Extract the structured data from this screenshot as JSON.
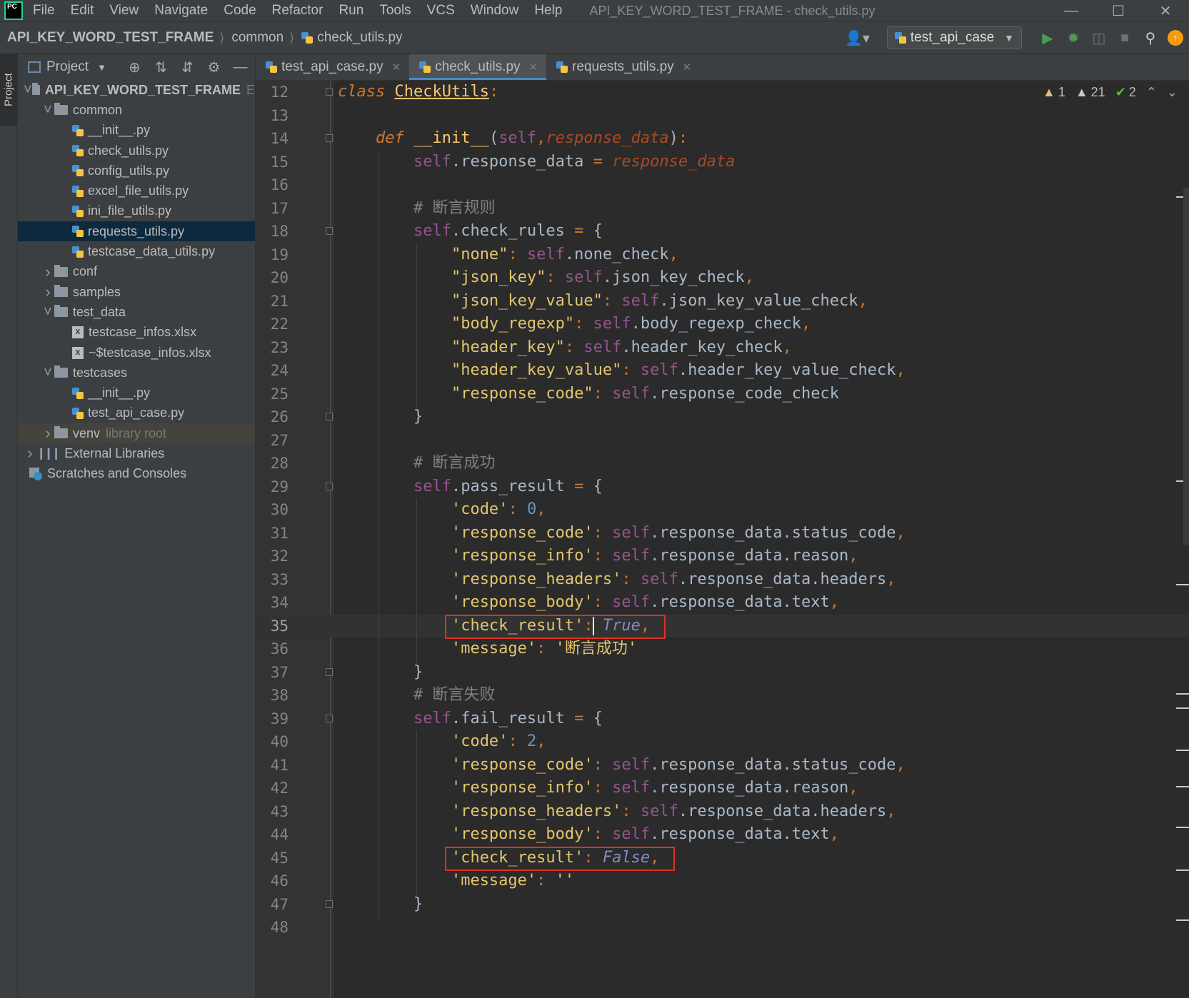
{
  "menu": {
    "logo": "PC",
    "items": [
      "File",
      "Edit",
      "View",
      "Navigate",
      "Code",
      "Refactor",
      "Run",
      "Tools",
      "VCS",
      "Window",
      "Help"
    ],
    "window_title": "API_KEY_WORD_TEST_FRAME - check_utils.py"
  },
  "breadcrumb": {
    "project": "API_KEY_WORD_TEST_FRAME",
    "folder": "common",
    "file": "check_utils.py"
  },
  "toolbar": {
    "run_config": "test_api_case"
  },
  "left_stripe": {
    "tab": "Project"
  },
  "project_panel": {
    "title": "Project",
    "tree": [
      {
        "label": "API_KEY_WORD_TEST_FRAME",
        "hint": "E",
        "type": "folder",
        "depth": 0,
        "expanded": true,
        "bold": true
      },
      {
        "label": "common",
        "type": "folder",
        "depth": 1,
        "expanded": true
      },
      {
        "label": "__init__.py",
        "type": "py",
        "depth": 2
      },
      {
        "label": "check_utils.py",
        "type": "py",
        "depth": 2
      },
      {
        "label": "config_utils.py",
        "type": "py",
        "depth": 2
      },
      {
        "label": "excel_file_utils.py",
        "type": "py",
        "depth": 2
      },
      {
        "label": "ini_file_utils.py",
        "type": "py",
        "depth": 2
      },
      {
        "label": "requests_utils.py",
        "type": "py",
        "depth": 2,
        "selected": true
      },
      {
        "label": "testcase_data_utils.py",
        "type": "py",
        "depth": 2
      },
      {
        "label": "conf",
        "type": "folder",
        "depth": 1,
        "expanded": false
      },
      {
        "label": "samples",
        "type": "folder",
        "depth": 1,
        "expanded": false
      },
      {
        "label": "test_data",
        "type": "folder",
        "depth": 1,
        "expanded": true
      },
      {
        "label": "testcase_infos.xlsx",
        "type": "xls",
        "depth": 2
      },
      {
        "label": "~$testcase_infos.xlsx",
        "type": "xls",
        "depth": 2
      },
      {
        "label": "testcases",
        "type": "folder",
        "depth": 1,
        "expanded": true
      },
      {
        "label": "__init__.py",
        "type": "py",
        "depth": 2
      },
      {
        "label": "test_api_case.py",
        "type": "py",
        "depth": 2
      },
      {
        "label": "venv",
        "hint": "library root",
        "type": "folder",
        "depth": 1,
        "expanded": false,
        "venv": true
      },
      {
        "label": "External Libraries",
        "type": "lib",
        "depth": 0,
        "expanded": false
      },
      {
        "label": "Scratches and Consoles",
        "type": "scratch",
        "depth": 0
      }
    ]
  },
  "tabs": [
    {
      "label": "test_api_case.py",
      "active": false
    },
    {
      "label": "check_utils.py",
      "active": true
    },
    {
      "label": "requests_utils.py",
      "active": false
    }
  ],
  "inspections": {
    "warnings_yellow": "1",
    "warnings": "21",
    "ok": "2"
  },
  "editor": {
    "current_line": 35,
    "lines": [
      {
        "n": "12",
        "fold": true,
        "tokens": [
          [
            "kwi",
            "class "
          ],
          [
            "cls",
            "CheckUtils"
          ],
          [
            "punc",
            ":"
          ]
        ]
      },
      {
        "n": "13",
        "tokens": []
      },
      {
        "n": "14",
        "fold": true,
        "tokens": [
          [
            "",
            "    "
          ],
          [
            "kwi",
            "def "
          ],
          [
            "fn",
            "__init__"
          ],
          [
            "",
            "("
          ],
          [
            "slf",
            "self"
          ],
          [
            "punc",
            ","
          ],
          [
            "param",
            "response_data"
          ],
          [
            "",
            ")"
          ],
          [
            "punc",
            ":"
          ]
        ]
      },
      {
        "n": "15",
        "tokens": [
          [
            "",
            "        "
          ],
          [
            "slf",
            "self"
          ],
          [
            "",
            ".response_data "
          ],
          [
            "punc",
            "="
          ],
          [
            "",
            " "
          ],
          [
            "param",
            "response_data"
          ]
        ]
      },
      {
        "n": "16",
        "tokens": []
      },
      {
        "n": "17",
        "tokens": [
          [
            "",
            "        "
          ],
          [
            "cmt",
            "# 断言规则"
          ]
        ]
      },
      {
        "n": "18",
        "fold": true,
        "tokens": [
          [
            "",
            "        "
          ],
          [
            "slf",
            "self"
          ],
          [
            "",
            ".check_rules "
          ],
          [
            "punc",
            "="
          ],
          [
            "",
            " {"
          ]
        ]
      },
      {
        "n": "19",
        "tokens": [
          [
            "",
            "            "
          ],
          [
            "str2",
            "\"none\""
          ],
          [
            "punc",
            ":"
          ],
          [
            "",
            " "
          ],
          [
            "slf",
            "self"
          ],
          [
            "",
            ".none_check"
          ],
          [
            "punc",
            ","
          ]
        ]
      },
      {
        "n": "20",
        "tokens": [
          [
            "",
            "            "
          ],
          [
            "str2",
            "\"json_key\""
          ],
          [
            "punc",
            ":"
          ],
          [
            "",
            " "
          ],
          [
            "slf",
            "self"
          ],
          [
            "",
            ".json_key_check"
          ],
          [
            "punc",
            ","
          ]
        ]
      },
      {
        "n": "21",
        "tokens": [
          [
            "",
            "            "
          ],
          [
            "str2",
            "\"json_key_value\""
          ],
          [
            "punc",
            ":"
          ],
          [
            "",
            " "
          ],
          [
            "slf",
            "self"
          ],
          [
            "",
            ".json_key_value_check"
          ],
          [
            "punc",
            ","
          ]
        ]
      },
      {
        "n": "22",
        "tokens": [
          [
            "",
            "            "
          ],
          [
            "str2",
            "\"body_regexp\""
          ],
          [
            "punc",
            ":"
          ],
          [
            "",
            " "
          ],
          [
            "slf",
            "self"
          ],
          [
            "",
            ".body_regexp_check"
          ],
          [
            "punc",
            ","
          ]
        ]
      },
      {
        "n": "23",
        "tokens": [
          [
            "",
            "            "
          ],
          [
            "str2",
            "\"header_key\""
          ],
          [
            "punc",
            ":"
          ],
          [
            "",
            " "
          ],
          [
            "slf",
            "self"
          ],
          [
            "",
            ".header_key_check"
          ],
          [
            "punc",
            ","
          ]
        ]
      },
      {
        "n": "24",
        "tokens": [
          [
            "",
            "            "
          ],
          [
            "str2",
            "\"header_key_value\""
          ],
          [
            "punc",
            ":"
          ],
          [
            "",
            " "
          ],
          [
            "slf",
            "self"
          ],
          [
            "",
            ".header_key_value_check"
          ],
          [
            "punc",
            ","
          ]
        ]
      },
      {
        "n": "25",
        "tokens": [
          [
            "",
            "            "
          ],
          [
            "str2",
            "\"response_code\""
          ],
          [
            "punc",
            ":"
          ],
          [
            "",
            " "
          ],
          [
            "slf",
            "self"
          ],
          [
            "",
            ".response_code_check"
          ]
        ]
      },
      {
        "n": "26",
        "fold": true,
        "tokens": [
          [
            "",
            "        }"
          ]
        ]
      },
      {
        "n": "27",
        "tokens": []
      },
      {
        "n": "28",
        "tokens": [
          [
            "",
            "        "
          ],
          [
            "cmt",
            "# 断言成功"
          ]
        ]
      },
      {
        "n": "29",
        "fold": true,
        "tokens": [
          [
            "",
            "        "
          ],
          [
            "slf",
            "self"
          ],
          [
            "",
            ".pass_result "
          ],
          [
            "punc",
            "="
          ],
          [
            "",
            " {"
          ]
        ]
      },
      {
        "n": "30",
        "tokens": [
          [
            "",
            "            "
          ],
          [
            "str2",
            "'code'"
          ],
          [
            "punc",
            ":"
          ],
          [
            "",
            " "
          ],
          [
            "num",
            "0"
          ],
          [
            "punc",
            ","
          ]
        ]
      },
      {
        "n": "31",
        "tokens": [
          [
            "",
            "            "
          ],
          [
            "str2",
            "'response_code'"
          ],
          [
            "punc",
            ":"
          ],
          [
            "",
            " "
          ],
          [
            "slf",
            "self"
          ],
          [
            "",
            ".response_data.status_code"
          ],
          [
            "punc",
            ","
          ]
        ]
      },
      {
        "n": "32",
        "tokens": [
          [
            "",
            "            "
          ],
          [
            "str2",
            "'response_info'"
          ],
          [
            "punc",
            ":"
          ],
          [
            "",
            " "
          ],
          [
            "slf",
            "self"
          ],
          [
            "",
            ".response_data.reason"
          ],
          [
            "punc",
            ","
          ]
        ]
      },
      {
        "n": "33",
        "tokens": [
          [
            "",
            "            "
          ],
          [
            "str2",
            "'response_headers'"
          ],
          [
            "punc",
            ":"
          ],
          [
            "",
            " "
          ],
          [
            "slf",
            "self"
          ],
          [
            "",
            ".response_data.headers"
          ],
          [
            "punc",
            ","
          ]
        ]
      },
      {
        "n": "34",
        "tokens": [
          [
            "",
            "            "
          ],
          [
            "str2",
            "'response_body'"
          ],
          [
            "punc",
            ":"
          ],
          [
            "",
            " "
          ],
          [
            "slf",
            "self"
          ],
          [
            "",
            ".response_data.text"
          ],
          [
            "punc",
            ","
          ]
        ]
      },
      {
        "n": "35",
        "tokens": [
          [
            "",
            "            "
          ],
          [
            "str2",
            "'check_result'"
          ],
          [
            "punc",
            ":"
          ],
          [
            "",
            " "
          ],
          [
            "bool",
            "True"
          ],
          [
            "punc",
            ","
          ]
        ]
      },
      {
        "n": "36",
        "tokens": [
          [
            "",
            "            "
          ],
          [
            "str2",
            "'message'"
          ],
          [
            "punc",
            ":"
          ],
          [
            "",
            " "
          ],
          [
            "str2",
            "'断言成功'"
          ]
        ]
      },
      {
        "n": "37",
        "fold": true,
        "tokens": [
          [
            "",
            "        }"
          ]
        ]
      },
      {
        "n": "38",
        "tokens": [
          [
            "",
            "        "
          ],
          [
            "cmt",
            "# 断言失败"
          ]
        ]
      },
      {
        "n": "39",
        "fold": true,
        "tokens": [
          [
            "",
            "        "
          ],
          [
            "slf",
            "self"
          ],
          [
            "",
            ".fail_result "
          ],
          [
            "punc",
            "="
          ],
          [
            "",
            " {"
          ]
        ]
      },
      {
        "n": "40",
        "tokens": [
          [
            "",
            "            "
          ],
          [
            "str2",
            "'code'"
          ],
          [
            "punc",
            ":"
          ],
          [
            "",
            " "
          ],
          [
            "num",
            "2"
          ],
          [
            "punc",
            ","
          ]
        ]
      },
      {
        "n": "41",
        "tokens": [
          [
            "",
            "            "
          ],
          [
            "str2",
            "'response_code'"
          ],
          [
            "punc",
            ":"
          ],
          [
            "",
            " "
          ],
          [
            "slf",
            "self"
          ],
          [
            "",
            ".response_data.status_code"
          ],
          [
            "punc",
            ","
          ]
        ]
      },
      {
        "n": "42",
        "tokens": [
          [
            "",
            "            "
          ],
          [
            "str2",
            "'response_info'"
          ],
          [
            "punc",
            ":"
          ],
          [
            "",
            " "
          ],
          [
            "slf",
            "self"
          ],
          [
            "",
            ".response_data.reason"
          ],
          [
            "punc",
            ","
          ]
        ]
      },
      {
        "n": "43",
        "tokens": [
          [
            "",
            "            "
          ],
          [
            "str2",
            "'response_headers'"
          ],
          [
            "punc",
            ":"
          ],
          [
            "",
            " "
          ],
          [
            "slf",
            "self"
          ],
          [
            "",
            ".response_data.headers"
          ],
          [
            "punc",
            ","
          ]
        ]
      },
      {
        "n": "44",
        "tokens": [
          [
            "",
            "            "
          ],
          [
            "str2",
            "'response_body'"
          ],
          [
            "punc",
            ":"
          ],
          [
            "",
            " "
          ],
          [
            "slf",
            "self"
          ],
          [
            "",
            ".response_data.text"
          ],
          [
            "punc",
            ","
          ]
        ]
      },
      {
        "n": "45",
        "tokens": [
          [
            "",
            "            "
          ],
          [
            "str2",
            "'check_result'"
          ],
          [
            "punc",
            ":"
          ],
          [
            "",
            " "
          ],
          [
            "bool",
            "False"
          ],
          [
            "punc",
            ","
          ]
        ]
      },
      {
        "n": "46",
        "tokens": [
          [
            "",
            "            "
          ],
          [
            "str2",
            "'message'"
          ],
          [
            "punc",
            ":"
          ],
          [
            "",
            " "
          ],
          [
            "str2",
            "''"
          ]
        ]
      },
      {
        "n": "47",
        "fold": true,
        "tokens": [
          [
            "",
            "        }"
          ]
        ]
      },
      {
        "n": "48",
        "tokens": []
      }
    ],
    "highlighted_lines": [
      35,
      45
    ]
  }
}
